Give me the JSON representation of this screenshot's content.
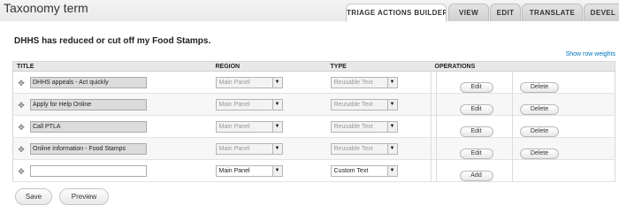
{
  "page": {
    "title": "Taxonomy term"
  },
  "tabs": [
    {
      "label": "TRIAGE ACTIONS BUILDER"
    },
    {
      "label": "VIEW"
    },
    {
      "label": "EDIT"
    },
    {
      "label": "TRANSLATE"
    },
    {
      "label": "DEVEL"
    }
  ],
  "headline": "DHHS has reduced or cut off my Food Stamps.",
  "show_row_weights": "Show row weights",
  "table": {
    "headers": {
      "title": "TITLE",
      "region": "REGION",
      "type": "TYPE",
      "operations": "OPERATIONS"
    },
    "rows": [
      {
        "title": "DHHS appeals - Act quickly",
        "region": "Main Panel",
        "type": "Reusable Text",
        "edit": "Edit",
        "delete": "Delete"
      },
      {
        "title": "Apply for Help Online",
        "region": "Main Panel",
        "type": "Reusable Text",
        "edit": "Edit",
        "delete": "Delete"
      },
      {
        "title": "Call PTLA",
        "region": "Main Panel",
        "type": "Reusable Text",
        "edit": "Edit",
        "delete": "Delete"
      },
      {
        "title": "Online Information - Food Stamps",
        "region": "Main Panel",
        "type": "Reusable Text",
        "edit": "Edit",
        "delete": "Delete"
      }
    ],
    "new_row": {
      "title": "",
      "region": "Main Panel",
      "type": "Custom Text",
      "add": "Add"
    }
  },
  "buttons": {
    "save": "Save",
    "preview": "Preview"
  },
  "colors": {
    "link": "#0074bd",
    "header_bg": "#e8e8e8"
  }
}
